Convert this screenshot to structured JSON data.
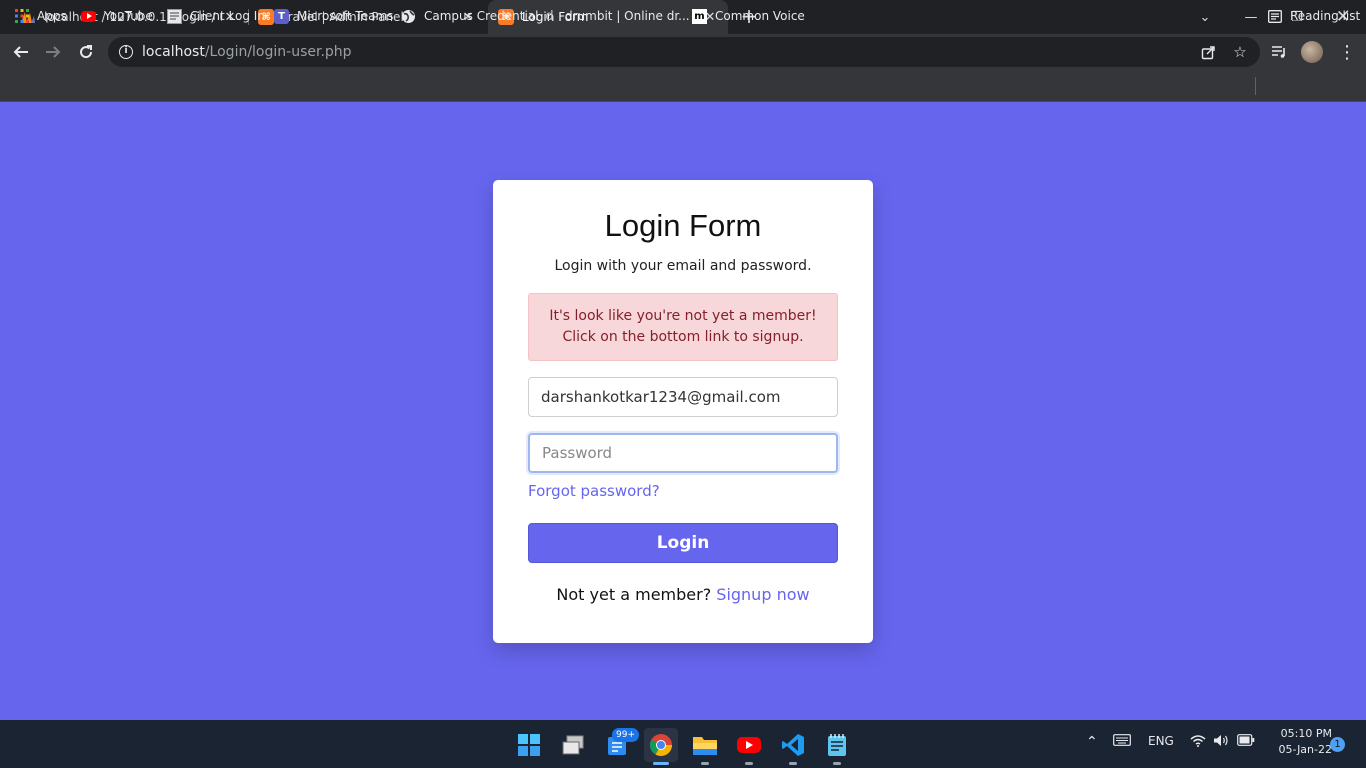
{
  "tabs": [
    {
      "title": "localhost / 127.0.0.1 / login / use",
      "icon": "phpmyadmin-icon"
    },
    {
      "title": "Travel | Admin Panel",
      "icon": "xampp-icon"
    },
    {
      "title": "Login Form",
      "icon": "xampp-icon",
      "active": true
    }
  ],
  "address_bar": {
    "host": "localhost",
    "path": "/Login/login-user.php"
  },
  "bookmarks": [
    {
      "label": "Apps",
      "icon": "apps-grid-icon"
    },
    {
      "label": "YouTube",
      "icon": "youtube-icon"
    },
    {
      "label": "Client Log In",
      "icon": "page-icon"
    },
    {
      "label": "Microsoft Teams",
      "icon": "teams-icon"
    },
    {
      "label": "Campus Credential",
      "icon": "globe-icon"
    },
    {
      "label": "drumbit | Online dr...",
      "icon": "drumbit-icon"
    },
    {
      "label": "Common Voice",
      "icon": "common-voice-icon"
    }
  ],
  "reading_list": "Reading list",
  "login": {
    "title": "Login Form",
    "subtitle": "Login with your email and password.",
    "alert_line1": "It's look like you're not yet a member!",
    "alert_line2": "Click on the bottom link to signup.",
    "email_value": "darshankotkar1234@gmail.com",
    "password_placeholder": "Password",
    "forgot_link": "Forgot password?",
    "login_button": "Login",
    "signup_prompt": "Not yet a member?",
    "signup_link": "Signup now"
  },
  "taskbar": {
    "badge": "99+",
    "language": "ENG",
    "time": "05:10 PM",
    "date": "05-Jan-22",
    "notifications": "1"
  },
  "colors": {
    "page_background": "#6665ee",
    "accent": "#6665ee",
    "alert_background": "#f8d7da",
    "alert_text": "#842029"
  }
}
